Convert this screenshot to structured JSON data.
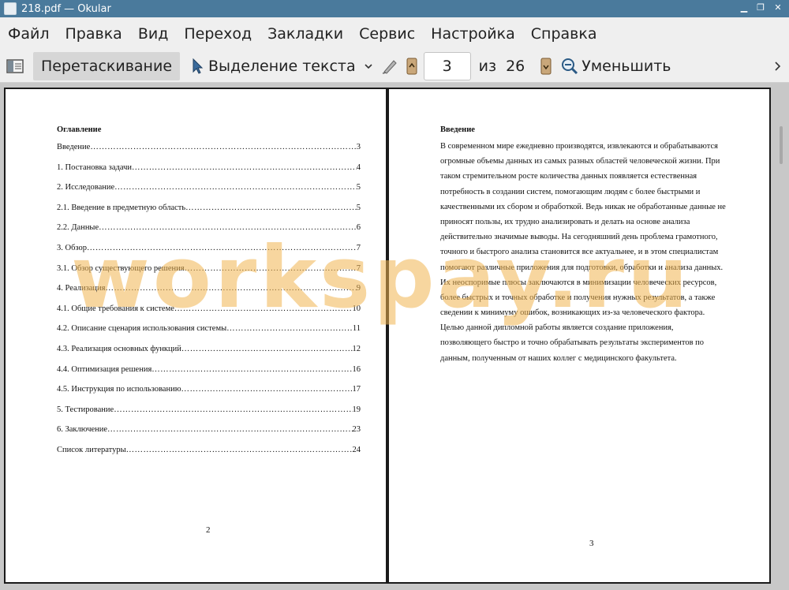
{
  "window": {
    "title": "218.pdf  — Okular"
  },
  "menu": [
    "Файл",
    "Правка",
    "Вид",
    "Переход",
    "Закладки",
    "Сервис",
    "Настройка",
    "Справка"
  ],
  "toolbar": {
    "browse_label": "Перетаскивание",
    "select_label": "Выделение текста",
    "page_value": "3",
    "of_label": "из",
    "total_pages": "26",
    "zoom_out_label": "Уменьшить"
  },
  "left_page": {
    "heading": "Оглавление",
    "toc": [
      {
        "title": "Введение",
        "page": "3"
      },
      {
        "title": "1. Постановка задачи",
        "page": "4"
      },
      {
        "title": "2. Исследование",
        "page": "5"
      },
      {
        "title": "2.1. Введение в предметную область",
        "page": "5"
      },
      {
        "title": "2.2. Данные",
        "page": "6"
      },
      {
        "title": "3. Обзор",
        "page": "7"
      },
      {
        "title": "3.1. Обзор существующего решения",
        "page": "7"
      },
      {
        "title": "4. Реализация",
        "page": "9"
      },
      {
        "title": "4.1. Общие требования к системе",
        "page": "10"
      },
      {
        "title": "4.2. Описание сценария использования системы",
        "page": "11"
      },
      {
        "title": "4.3. Реализация основных функций",
        "page": "12"
      },
      {
        "title": "4.4. Оптимизация решения",
        "page": "16"
      },
      {
        "title": "4.5. Инструкция по использованию",
        "page": "17"
      },
      {
        "title": "5. Тестирование",
        "page": "19"
      },
      {
        "title": "6. Заключение",
        "page": "23"
      },
      {
        "title": "Список литературы",
        "page": "24"
      }
    ],
    "page_number": "2"
  },
  "right_page": {
    "heading": "Введение",
    "lines": [
      "В современном мире ежедневно производятся, извлекаются и обрабатываются",
      "огромные объемы данных из самых разных областей человеческой жизни. При",
      "таком стремительном росте количества данных появляется естественная",
      "потребность в создании систем, помогающим людям с более быстрыми и",
      "качественными их сбором и обработкой. Ведь никак не обработанные данные не",
      "приносят пользы, их трудно анализировать и делать на основе анализа",
      "действительно значимые выводы. На сегодняшний день проблема грамотного,",
      "точного и быстрого анализа становится все актуальнее, и в этом специалистам",
      "помогают различные приложения для подготовки, обработки и анализа данных.",
      "Их неоспоримые плюсы заключаются в минимизации человеческих ресурсов,",
      "более быстрых и точных обработке и получения нужных результатов, а также",
      "сведении к минимуму ошибок, возникающих из-за человеческого фактора.",
      "Целью данной дипломной работы является создание приложения,",
      "позволяющего быстро и точно обрабатывать результаты экспериментов по",
      "данным, полученным от наших коллег с медицинского факультета."
    ],
    "page_number": "3"
  },
  "watermark": "workspay.ru"
}
